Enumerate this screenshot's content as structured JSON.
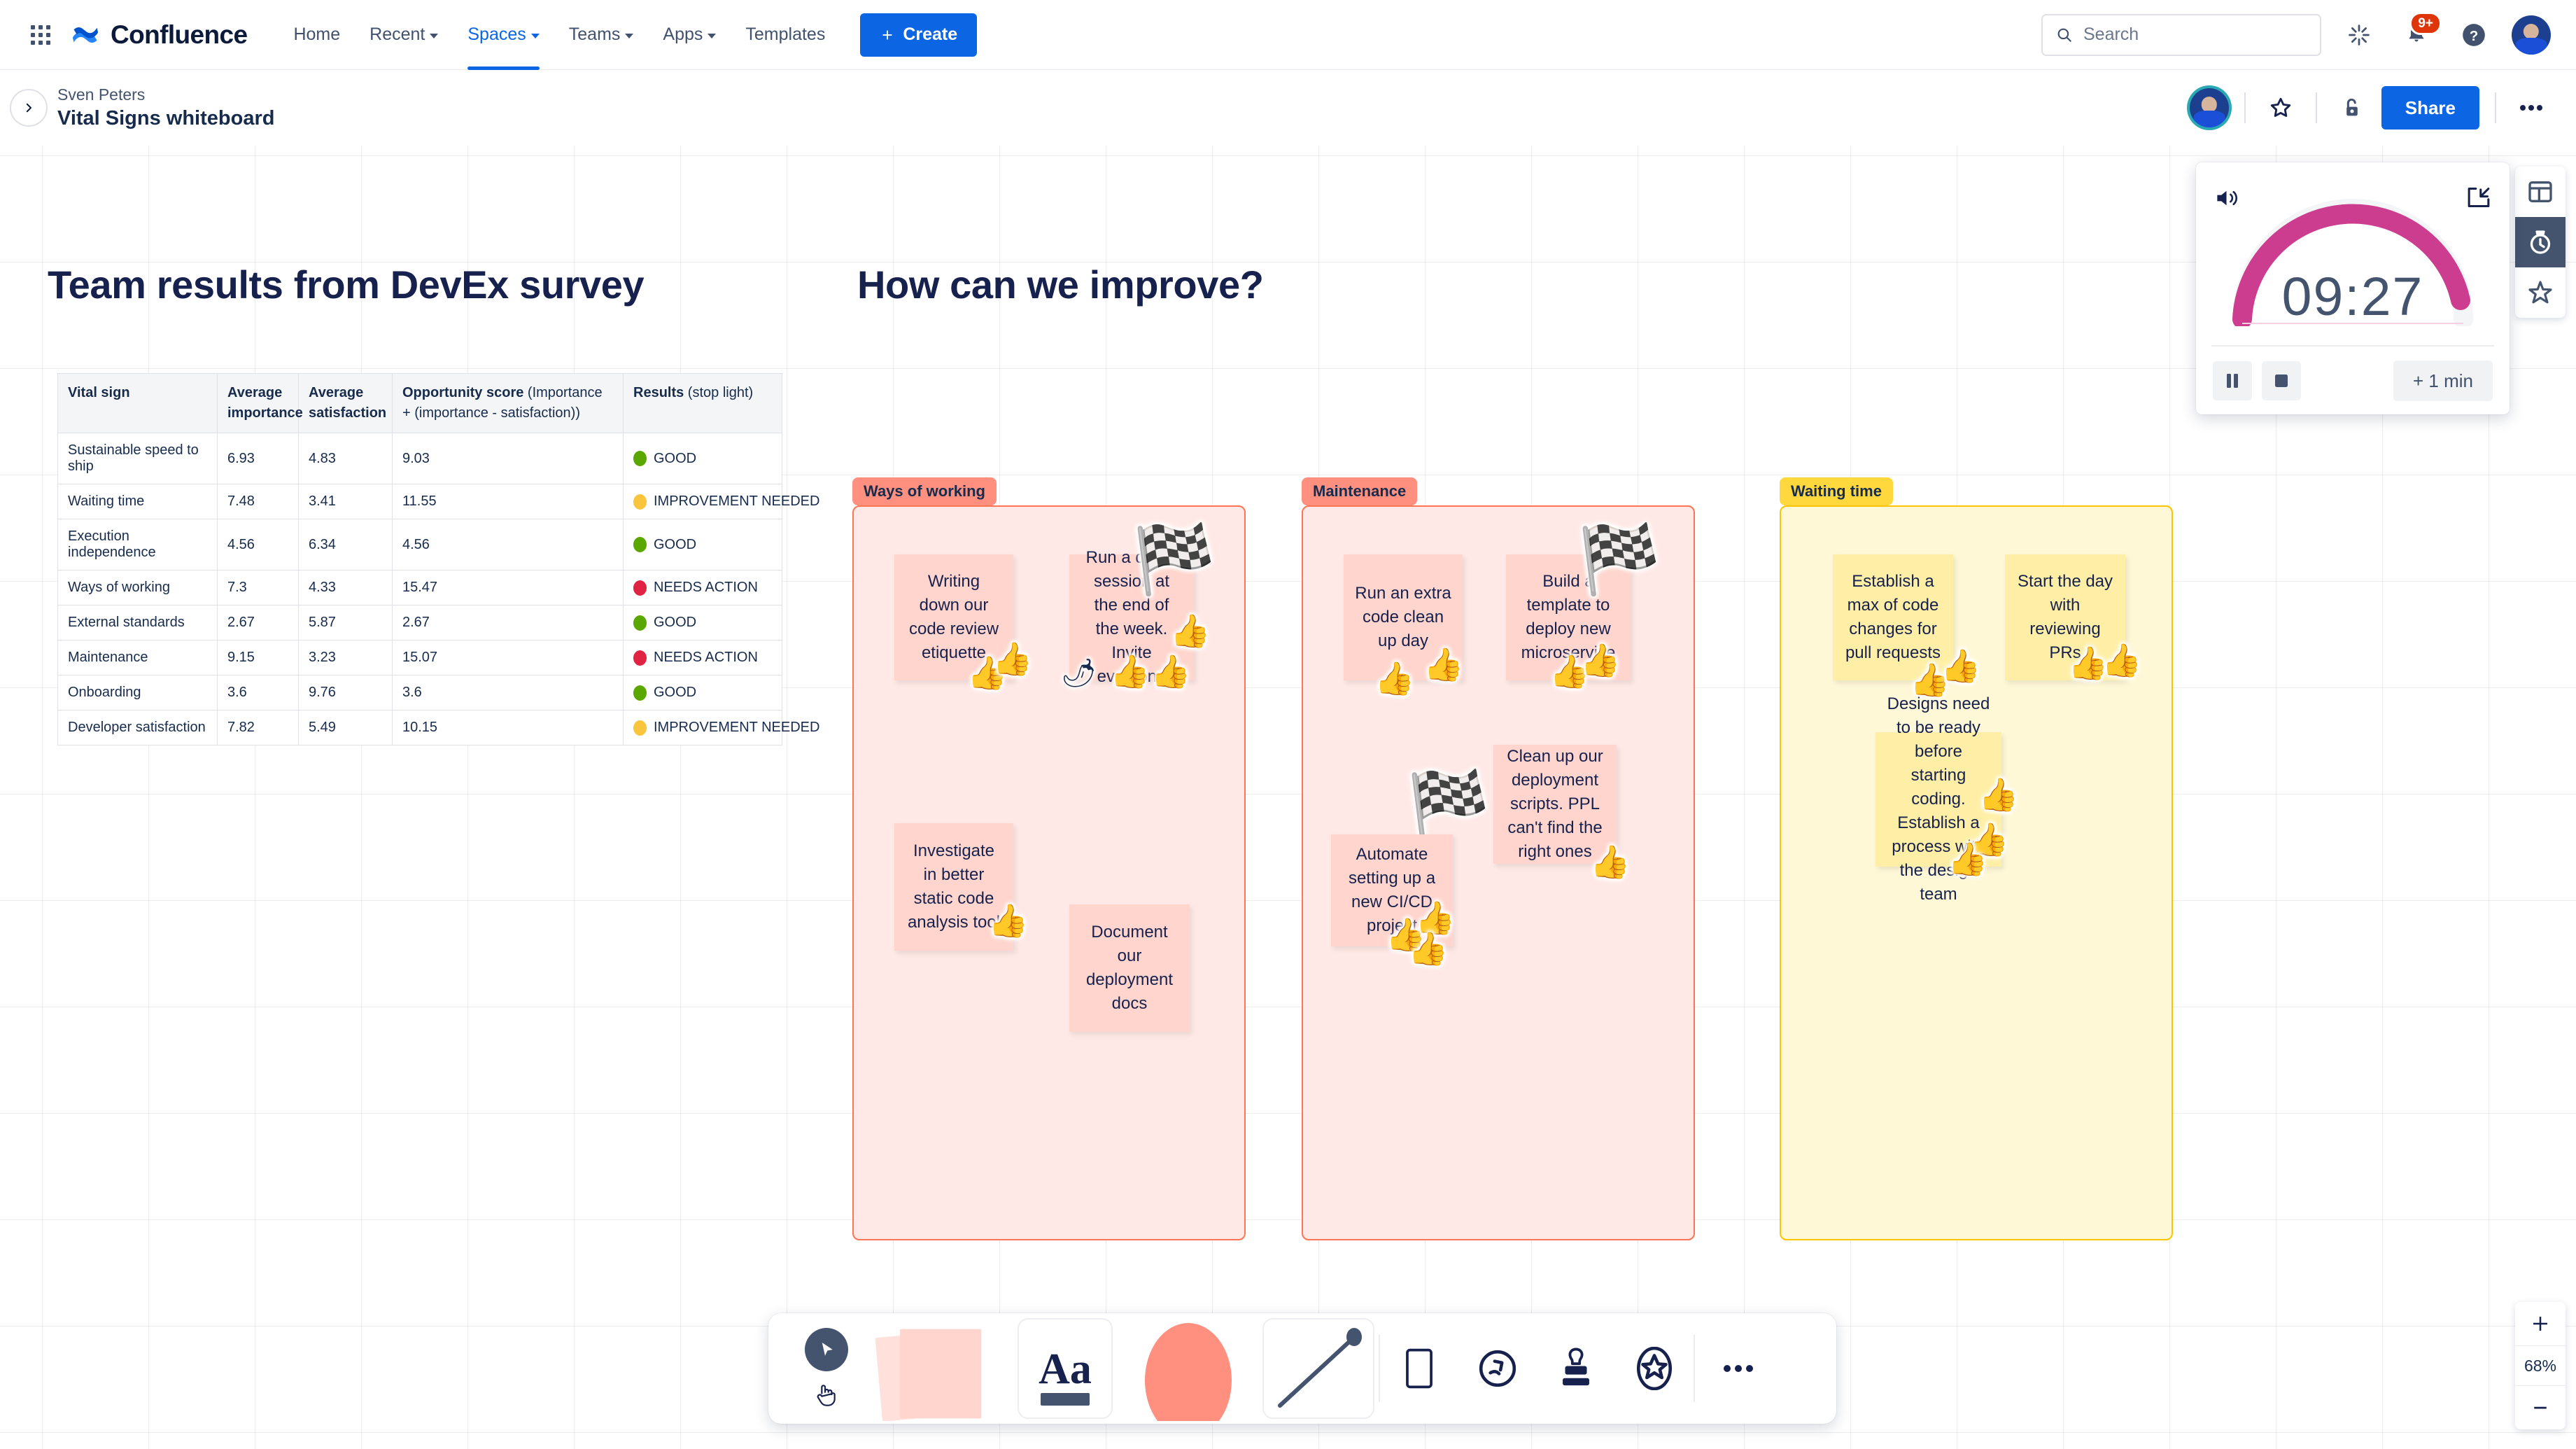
{
  "global_nav": {
    "app_switcher_icon": "app-switcher-icon",
    "brand": "Confluence",
    "items": [
      {
        "label": "Home",
        "has_caret": false,
        "active": false
      },
      {
        "label": "Recent",
        "has_caret": true,
        "active": false
      },
      {
        "label": "Spaces",
        "has_caret": true,
        "active": true
      },
      {
        "label": "Teams",
        "has_caret": true,
        "active": false
      },
      {
        "label": "Apps",
        "has_caret": true,
        "active": false
      },
      {
        "label": "Templates",
        "has_caret": false,
        "active": false
      }
    ],
    "create_label": "Create",
    "search_placeholder": "Search",
    "icons": {
      "search": "search-icon",
      "spark": "atlassian-intelligence-icon",
      "notifications": "notifications-bell-icon",
      "help": "help-icon",
      "profile": "profile-avatar"
    },
    "notification_badge": "9+"
  },
  "page_header": {
    "expand_icon": "expand-sidebar-chevron-icon",
    "breadcrumb": "Sven Peters",
    "title": "Vital Signs whiteboard",
    "collaborator_avatar": "collaborator-avatar",
    "star_icon": "star-icon",
    "restrictions_icon": "unlock-icon",
    "share_label": "Share",
    "more_icon": "more-actions-icon"
  },
  "canvas": {
    "heading_left": "Team results from DevEx survey",
    "heading_right": "How can we improve?",
    "table": {
      "columns": [
        {
          "main": "Vital sign",
          "sub": ""
        },
        {
          "main": "Average importance",
          "sub": ""
        },
        {
          "main": "Average satisfaction",
          "sub": ""
        },
        {
          "main": "Opportunity score",
          "sub": " (Importance + (importance - satisfaction))"
        },
        {
          "main": "Results",
          "sub": " (stop light)"
        }
      ],
      "rows": [
        {
          "vital_sign": "Sustainable speed to ship",
          "importance": "6.93",
          "satisfaction": "4.83",
          "opportunity": "9.03",
          "result": "GOOD",
          "color": "#5aa700"
        },
        {
          "vital_sign": "Waiting time",
          "importance": "7.48",
          "satisfaction": "3.41",
          "opportunity": "11.55",
          "result": "IMPROVEMENT NEEDED",
          "color": "#f8c53c"
        },
        {
          "vital_sign": "Execution independence",
          "importance": "4.56",
          "satisfaction": "6.34",
          "opportunity": "4.56",
          "result": "GOOD",
          "color": "#5aa700"
        },
        {
          "vital_sign": "Ways of working",
          "importance": "7.3",
          "satisfaction": "4.33",
          "opportunity": "15.47",
          "result": "NEEDS ACTION",
          "color": "#e02243"
        },
        {
          "vital_sign": "External standards",
          "importance": "2.67",
          "satisfaction": "5.87",
          "opportunity": "2.67",
          "result": "GOOD",
          "color": "#5aa700"
        },
        {
          "vital_sign": "Maintenance",
          "importance": "9.15",
          "satisfaction": "3.23",
          "opportunity": "15.07",
          "result": "NEEDS ACTION",
          "color": "#e02243"
        },
        {
          "vital_sign": "Onboarding",
          "importance": "3.6",
          "satisfaction": "9.76",
          "opportunity": "3.6",
          "result": "GOOD",
          "color": "#5aa700"
        },
        {
          "vital_sign": "Developer satisfaction",
          "importance": "7.82",
          "satisfaction": "5.49",
          "opportunity": "10.15",
          "result": "IMPROVEMENT NEEDED",
          "color": "#f8c53c"
        }
      ]
    },
    "groups": [
      {
        "label": "Ways of working",
        "label_bg": "#ff8f7e",
        "body_bg": "#ffe9e6",
        "border": "#ff7452",
        "notes": [
          {
            "text": "Writing down our code review etiquette",
            "bg": "#ffd5cd"
          },
          {
            "text": "Run a demo session at the end of the week. Invite everyone",
            "bg": "#ffd5cd"
          },
          {
            "text": "Investigate in better static code analysis tool",
            "bg": "#ffd5cd"
          },
          {
            "text": "Document our deployment docs",
            "bg": "#ffd5cd"
          }
        ]
      },
      {
        "label": "Maintenance",
        "label_bg": "#ff8f7e",
        "body_bg": "#ffe9e6",
        "border": "#ff7452",
        "notes": [
          {
            "text": "Run an extra code clean up day",
            "bg": "#ffd5cd"
          },
          {
            "text": "Build a template to deploy new microservice",
            "bg": "#ffd5cd"
          },
          {
            "text": "Clean up our deployment scripts. PPL can't find the right ones",
            "bg": "#ffd5cd"
          },
          {
            "text": "Automate setting up a new CI/CD project",
            "bg": "#ffd5cd"
          }
        ]
      },
      {
        "label": "Waiting time",
        "label_bg": "#ffd83d",
        "body_bg": "#fff8d6",
        "border": "#ffc400",
        "notes": [
          {
            "text": "Establish a max of code changes for pull requests",
            "bg": "#ffefa6"
          },
          {
            "text": "Start the day with reviewing PRs",
            "bg": "#ffefa6"
          },
          {
            "text": "Designs need to be ready before starting coding. Establish a process with the design team",
            "bg": "#ffefa6"
          }
        ]
      }
    ],
    "stickers": {
      "thumbs_up": "👍",
      "start_flag": "🏁",
      "chili": "🌶"
    }
  },
  "timer": {
    "sound_icon": "speaker-volume-icon",
    "collapse_icon": "minimize-widget-icon",
    "time": "09:27",
    "progress_ratio": 0.95,
    "arc_color": "#cc3d8f",
    "pause_icon": "pause-icon",
    "stop_icon": "stop-icon",
    "add_minute_label": "+ 1 min"
  },
  "right_rail": [
    {
      "name": "templates-icon",
      "active": false
    },
    {
      "name": "timer-icon",
      "active": true
    },
    {
      "name": "stickers-icon",
      "active": false
    }
  ],
  "zoom_control": {
    "zoom_in_icon": "plus-icon",
    "level": "68%",
    "zoom_out_icon": "minus-icon"
  },
  "toolbar": {
    "tools": [
      {
        "name": "select-tool",
        "icon": "cursor-arrow-icon"
      },
      {
        "name": "hand-tool",
        "icon": "hand-pan-icon"
      },
      {
        "name": "sticky-note-tool",
        "icon": "sticky-notes-icon"
      },
      {
        "name": "text-tool",
        "icon": "text-Aa-icon",
        "label": "Aa"
      },
      {
        "name": "shape-tool",
        "icon": "shape-ellipse-icon"
      },
      {
        "name": "line-tool",
        "icon": "line-connector-icon"
      },
      {
        "name": "section-tool",
        "icon": "section-frame-icon"
      },
      {
        "name": "smart-link-tool",
        "icon": "smart-link-icon"
      },
      {
        "name": "stamp-tool",
        "icon": "stamp-icon"
      },
      {
        "name": "sticker-tool",
        "icon": "sticker-star-icon"
      },
      {
        "name": "more-tools",
        "icon": "more-horizontal-icon"
      }
    ]
  }
}
